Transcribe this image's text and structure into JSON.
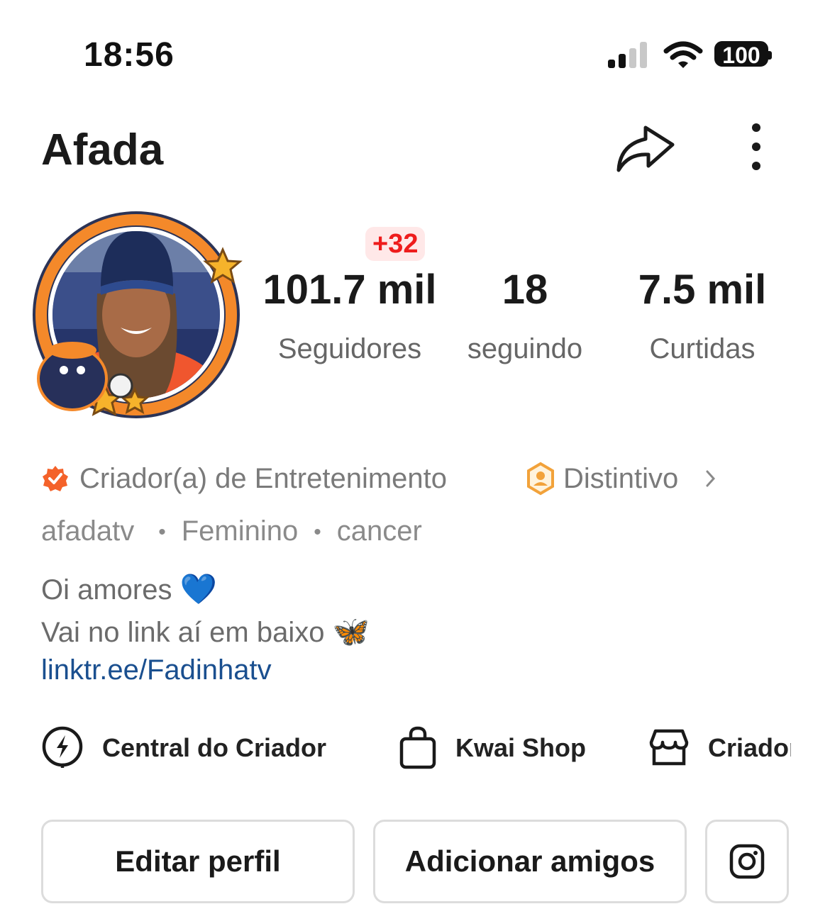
{
  "status_bar": {
    "time": "18:56",
    "battery": "100"
  },
  "profile": {
    "name": "Afada",
    "new_followers_badge": "+32",
    "stats": [
      {
        "value": "101.7 mil",
        "label": "Seguidores"
      },
      {
        "value": "18",
        "label": "seguindo"
      },
      {
        "value": "7.5 mil",
        "label": "Curtidas"
      }
    ],
    "category": "Criador(a) de Entretenimento",
    "badge_label": "Distintivo",
    "handle": "afadatv",
    "gender": "Feminino",
    "sign": "cancer",
    "bio_line1": "Oi amores",
    "bio_line1_emoji": "💙",
    "bio_line2": "Vai no link aí em baixo",
    "bio_line2_emoji": "🦋",
    "link": "linktr.ee/Fadinhatv"
  },
  "tools": [
    {
      "label": "Central do Criador",
      "icon": "lightning-icon"
    },
    {
      "label": "Kwai Shop",
      "icon": "shopping-bag-icon"
    },
    {
      "label": "Criador",
      "icon": "store-icon"
    }
  ],
  "actions": {
    "edit_profile": "Editar perfil",
    "add_friends": "Adicionar amigos",
    "instagram": "instagram-icon"
  },
  "colors": {
    "accent_red": "#ee1c1c",
    "verified_orange": "#f4622a",
    "badge_gold": "#f2a23a",
    "link_blue": "#1a4f8f"
  }
}
